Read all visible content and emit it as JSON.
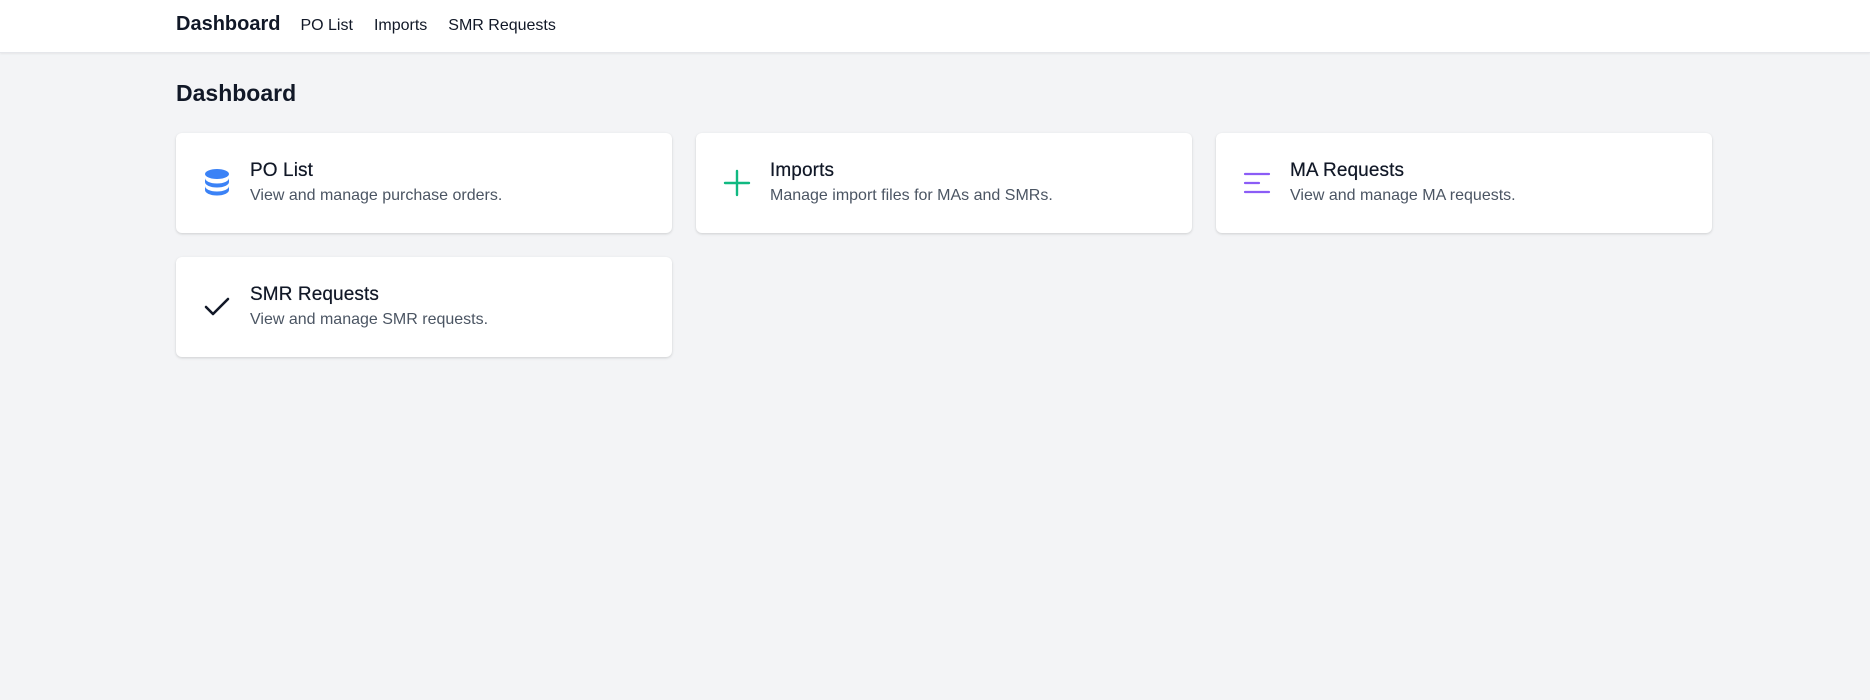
{
  "nav": {
    "brand": "Dashboard",
    "links": [
      "PO List",
      "Imports",
      "SMR Requests"
    ]
  },
  "page": {
    "title": "Dashboard"
  },
  "cards": [
    {
      "title": "PO List",
      "description": "View and manage purchase orders.",
      "icon": "database-icon",
      "icon_color": "#3b82f6"
    },
    {
      "title": "Imports",
      "description": "Manage import files for MAs and SMRs.",
      "icon": "plus-icon",
      "icon_color": "#10b981"
    },
    {
      "title": "MA Requests",
      "description": "View and manage MA requests.",
      "icon": "menu-lines-icon",
      "icon_color": "#8b5cf6"
    },
    {
      "title": "SMR Requests",
      "description": "View and manage SMR requests.",
      "icon": "check-icon",
      "icon_color": "#111827"
    }
  ],
  "colors": {
    "background": "#f3f4f6",
    "card": "#ffffff",
    "text_primary": "#111827",
    "text_secondary": "#4b5563"
  }
}
